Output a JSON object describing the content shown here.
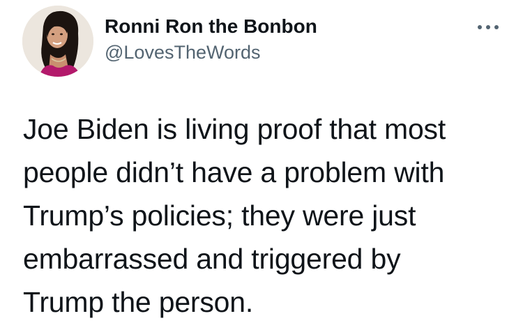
{
  "author": {
    "display_name": "Ronni Ron the Bonbon",
    "handle": "@LovesTheWords",
    "avatar_icon": "profile-photo"
  },
  "menu": {
    "icon": "more-horizontal-icon"
  },
  "tweet": {
    "lines": [
      "Joe Biden is living proof that most",
      "people didn’t have a problem with",
      "Trump’s policies; they were just",
      "embarrassed and triggered by",
      "Trump the person."
    ]
  },
  "colors": {
    "text_primary": "#0f1419",
    "text_secondary": "#536471",
    "background": "#ffffff"
  }
}
